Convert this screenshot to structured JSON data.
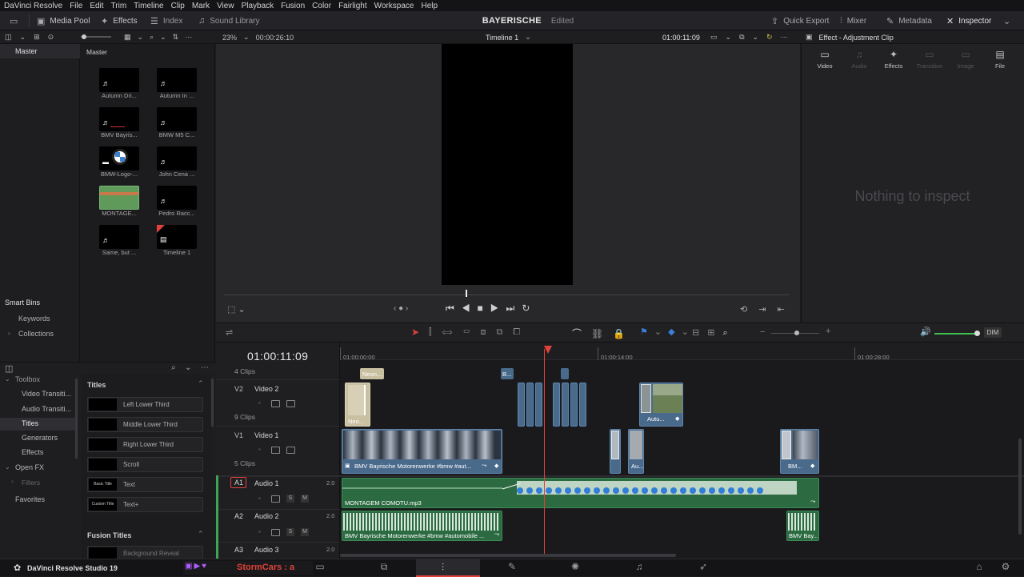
{
  "menubar": {
    "items": [
      "DaVinci Resolve",
      "File",
      "Edit",
      "Trim",
      "Timeline",
      "Clip",
      "Mark",
      "View",
      "Playback",
      "Fusion",
      "Color",
      "Fairlight",
      "Workspace",
      "Help"
    ]
  },
  "toolbar": {
    "media_pool": "Media Pool",
    "effects": "Effects",
    "index": "Index",
    "sound_library": "Sound Library",
    "project_name": "BAYERISCHE",
    "project_status": "Edited",
    "quick_export": "Quick Export",
    "mixer": "Mixer",
    "metadata": "Metadata",
    "inspector": "Inspector"
  },
  "viewer": {
    "zoom": "23%",
    "duration": "00:00:26:10",
    "timeline_name": "Timeline 1",
    "timecode": "01:00:11:09"
  },
  "inspector": {
    "title": "Effect - Adjustment Clip",
    "tabs": [
      "Video",
      "Audio",
      "Effects",
      "Transition",
      "Image",
      "File"
    ],
    "empty_message": "Nothing to inspect"
  },
  "left_panel": {
    "master": "Master",
    "smart_bins": "Smart Bins",
    "keywords": "Keywords",
    "collections": "Collections"
  },
  "bin": {
    "title": "Master",
    "clips": [
      {
        "name": "Autumn Dri..."
      },
      {
        "name": "Autumn In ..."
      },
      {
        "name": "BMV Bayris..."
      },
      {
        "name": "BMW M5 C..."
      },
      {
        "name": "BMW-Logo-..."
      },
      {
        "name": "John Cena ..."
      },
      {
        "name": "MONTAGE..."
      },
      {
        "name": "Pedro Racc..."
      },
      {
        "name": "Same, but ..."
      },
      {
        "name": "Timeline 1"
      }
    ]
  },
  "effects_panel": {
    "toolbox": "Toolbox",
    "categories": [
      "Video Transiti...",
      "Audio Transiti...",
      "Titles",
      "Generators",
      "Effects"
    ],
    "open_fx": "Open FX",
    "filters": "Filters",
    "favorites": "Favorites",
    "titles_header": "Titles",
    "titles": [
      {
        "name": "Left Lower Third"
      },
      {
        "name": "Middle Lower Third"
      },
      {
        "name": "Right Lower Third"
      },
      {
        "name": "Scroll"
      },
      {
        "name": "Text",
        "thumb": "Basic Title"
      },
      {
        "name": "Text+",
        "thumb": "Custom Title"
      }
    ],
    "fusion_titles_header": "Fusion Titles",
    "fusion_titles_first": "Background Reveal"
  },
  "timeline": {
    "timecode": "01:00:11:09",
    "ruler": [
      "01:00:00:00",
      "01:00:14:00",
      "01:00:28:00"
    ],
    "tracks": {
      "v3_clips": "4 Clips",
      "v2": {
        "id": "V2",
        "name": "Video 2",
        "clips": "9 Clips"
      },
      "v1": {
        "id": "V1",
        "name": "Video 1",
        "clips": "5 Clips"
      },
      "a1": {
        "id": "A1",
        "name": "Audio 1",
        "level": "2.0"
      },
      "a2": {
        "id": "A2",
        "name": "Audio 2",
        "level": "2.0"
      },
      "a3": {
        "id": "A3",
        "name": "Audio 3",
        "level": "2.0"
      }
    },
    "clip_labels": {
      "neon_top": "Neon...",
      "b_top": "B...",
      "neon_v2": "Neo...",
      "autu_v2": "Autu...",
      "v1_main": "BMV Bayrische Motorenwerke #bmw #aut...",
      "v1_au": "Au...",
      "v1_bm": "BM...",
      "a1_main": "MONTAGEM COMOTU.mp3",
      "a2_main": "BMV Bayrische Motorenwerke #bmw #automobile ...",
      "a2_end": "BMV Bay..."
    },
    "dim": "DIM"
  },
  "statusbar": {
    "app": "DaVinci Resolve Studio 19",
    "overlay": "StormCars : a"
  },
  "colors": {
    "accent_red": "#e0413a",
    "video_clip": "#4a6a8c",
    "audio_clip": "#2c6b41",
    "waveform": "#d8e8dc"
  }
}
